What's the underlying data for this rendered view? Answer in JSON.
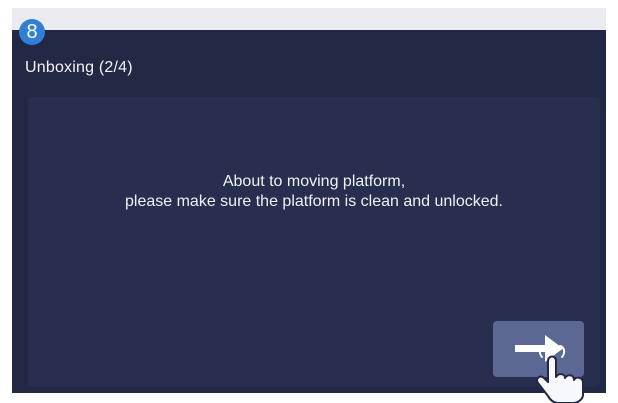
{
  "step": {
    "number": "8"
  },
  "screen": {
    "title": "Unboxing (2/4)",
    "message_line_1": "About to moving platform,",
    "message_line_2": "please make sure the platform is clean and unlocked."
  },
  "icons": {
    "next": "right-arrow-icon",
    "pointer": "tapping-hand-icon"
  },
  "colors": {
    "screen_bg": "#232845",
    "panel_bg": "#282e4e",
    "button_bg": "#5a6893",
    "badge": "#2f7fd6"
  }
}
